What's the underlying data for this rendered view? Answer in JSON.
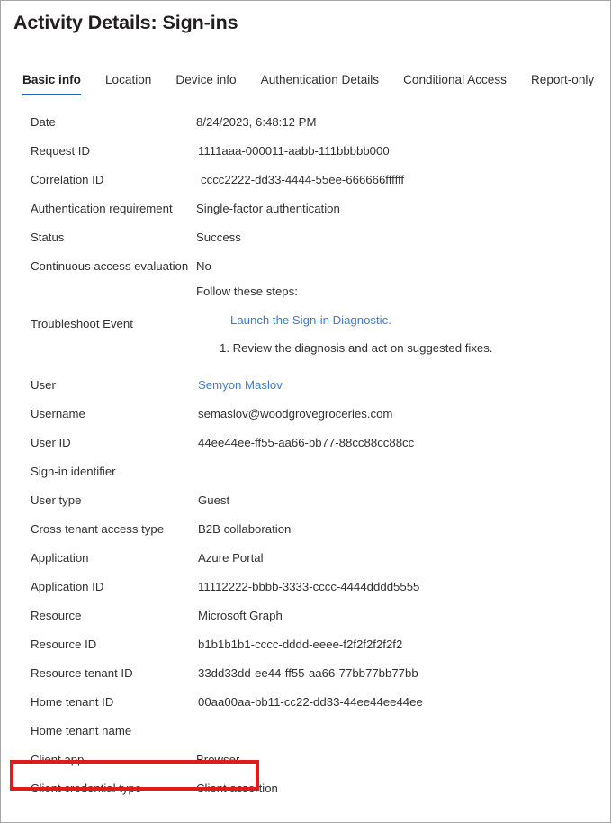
{
  "window": {
    "title": "Activity Details: Sign-ins",
    "border_color": "#a6a6a6",
    "background": "#ffffff"
  },
  "tabs": {
    "active": "Basic info",
    "accent_color": "#0f6cbd",
    "items": [
      {
        "label": "Basic info"
      },
      {
        "label": "Location"
      },
      {
        "label": "Device info"
      },
      {
        "label": "Authentication Details"
      },
      {
        "label": "Conditional Access"
      },
      {
        "label": "Report-only"
      }
    ]
  },
  "details": {
    "rows_top": [
      {
        "label": "Date",
        "value": "8/24/2023, 6:48:12 PM"
      },
      {
        "label": "Request ID",
        "value": "1111aaa-000011-aabb-111bbbbb000"
      },
      {
        "label": "Correlation ID",
        "value": "cccc2222-dd33-4444-55ee-666666ffffff"
      },
      {
        "label": "Authentication requirement",
        "value": "Single-factor authentication"
      },
      {
        "label": "Status",
        "value": "Success"
      },
      {
        "label": "Continuous access evaluation",
        "value": "No"
      }
    ],
    "troubleshoot": {
      "label": "Troubleshoot Event",
      "intro": "Follow these steps:",
      "link": "Launch the Sign-in Diagnostic.",
      "step1": "1. Review the diagnosis and act on suggested fixes."
    },
    "rows_bottom": [
      {
        "label": "User",
        "value": "Semyon Maslov"
      },
      {
        "label": "Username",
        "value": "semaslov@woodgrovegroceries.com"
      },
      {
        "label": "User ID",
        "value": "44ee44ee-ff55-aa66-bb77-88cc88cc88cc"
      },
      {
        "label": "Sign-in identifier",
        "value": ""
      },
      {
        "label": "User type",
        "value": "Guest"
      },
      {
        "label": "Cross tenant access type",
        "value": "B2B collaboration"
      },
      {
        "label": "Application",
        "value": "Azure Portal"
      },
      {
        "label": "Application ID",
        "value": "11112222-bbbb-3333-cccc-4444dddd5555"
      },
      {
        "label": "Resource",
        "value": "Microsoft Graph"
      },
      {
        "label": "Resource ID",
        "value": "b1b1b1b1-cccc-dddd-eeee-f2f2f2f2f2f2"
      },
      {
        "label": "Resource tenant ID",
        "value": "33dd33dd-ee44-ff55-aa66-77bb77bb77bb"
      },
      {
        "label": "Home tenant ID",
        "value": "00aa00aa-bb11-cc22-dd33-44ee44ee44ee"
      },
      {
        "label": "Home tenant name",
        "value": ""
      },
      {
        "label": "Client app",
        "value": "Browser"
      },
      {
        "label": "Client credential type",
        "value": "Client assertion"
      }
    ]
  },
  "annotation": {
    "highlight_color": "#e01b1b",
    "highlighted_row_label": "Client app"
  }
}
